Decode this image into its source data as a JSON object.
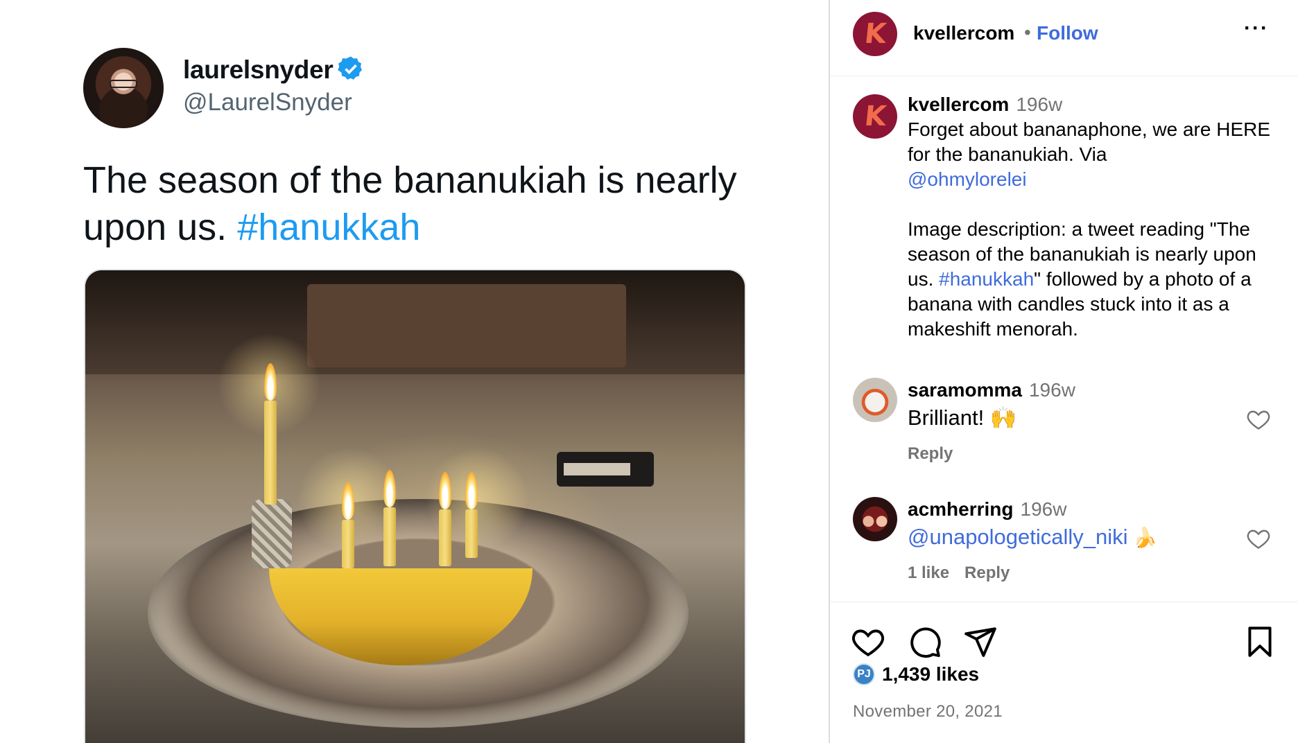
{
  "tweet": {
    "name": "laurelsnyder",
    "handle": "@LaurelSnyder",
    "text_before_tag": "The season of the bananukiah is nearly upon us.",
    "hashtag": "#hanukkah",
    "icons": {
      "verified": "verified-badge-icon",
      "photo": "banana-menorah-photo"
    },
    "colors": {
      "hashtag": "#1d9bf0",
      "verified": "#1d9bf0"
    }
  },
  "post": {
    "header": {
      "username": "kvellercom",
      "separator": "•",
      "follow_label": "Follow",
      "more": "more-options-icon"
    },
    "caption": {
      "username": "kvellercom",
      "time": "196w",
      "line1": "Forget about bananaphone, we are HERE for the bananukiah. Via",
      "mention": "@ohmylorelei",
      "desc_before_tag": "Image description: a tweet reading \"The season of the bananukiah is nearly upon us.",
      "desc_tag": "#hanukkah",
      "desc_after_tag": "\" followed by a photo of a banana with candles stuck into it as a makeshift menorah."
    },
    "comments": [
      {
        "username": "saramomma",
        "time": "196w",
        "text": "Brilliant! 🙌",
        "reply": "Reply"
      },
      {
        "username": "acmherring",
        "time": "196w",
        "mention": "@unapologetically_niki",
        "emoji": "🍌",
        "likes": "1 like",
        "reply": "Reply"
      }
    ],
    "likes_count": "1,439 likes",
    "likes_badge": "PJ",
    "date": "November 20, 2021",
    "colors": {
      "link": "#3f6bdc",
      "brand": "#8c1435",
      "brand_letter": "#f26b4a",
      "muted": "#737373"
    }
  }
}
